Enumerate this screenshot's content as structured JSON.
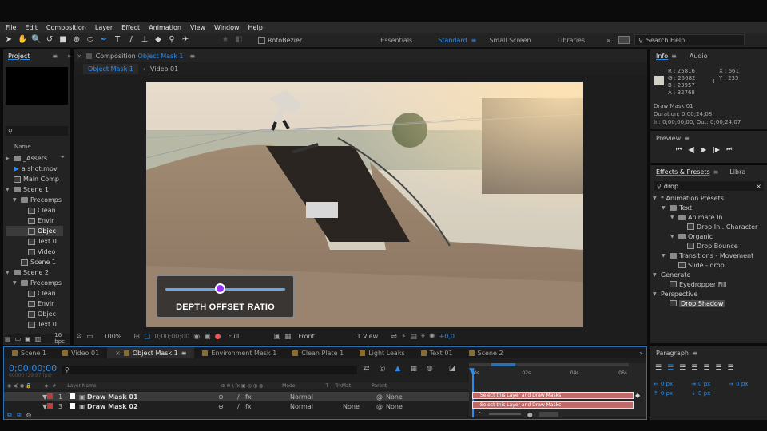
{
  "menu": [
    "File",
    "Edit",
    "Composition",
    "Layer",
    "Effect",
    "Animation",
    "View",
    "Window",
    "Help"
  ],
  "toolbar": {
    "roto_label": "RotoBezier",
    "workspaces": [
      "Essentials",
      "Standard",
      "Small Screen",
      "Libraries"
    ],
    "search_placeholder": "Search Help"
  },
  "project": {
    "tab": "Project",
    "name_header": "Name",
    "items": [
      {
        "label": "_Assets",
        "type": "folder",
        "indent": 0,
        "open": false
      },
      {
        "label": "a shot.mov",
        "type": "footage",
        "indent": 0
      },
      {
        "label": "Main Comp",
        "type": "comp",
        "indent": 0
      },
      {
        "label": "Scene 1",
        "type": "folder",
        "indent": 0,
        "open": true
      },
      {
        "label": "Precomps",
        "type": "folder",
        "indent": 1,
        "open": true
      },
      {
        "label": "Clean",
        "type": "comp",
        "indent": 2
      },
      {
        "label": "Envir",
        "type": "comp",
        "indent": 2
      },
      {
        "label": "Objec",
        "type": "comp",
        "indent": 2,
        "selected": true
      },
      {
        "label": "Text 0",
        "type": "comp",
        "indent": 2
      },
      {
        "label": "Video",
        "type": "comp",
        "indent": 2
      },
      {
        "label": "Scene 1",
        "type": "comp",
        "indent": 1
      },
      {
        "label": "Scene 2",
        "type": "folder",
        "indent": 0,
        "open": true
      },
      {
        "label": "Precomps",
        "type": "folder",
        "indent": 1,
        "open": true
      },
      {
        "label": "Clean",
        "type": "comp",
        "indent": 2
      },
      {
        "label": "Envir",
        "type": "comp",
        "indent": 2
      },
      {
        "label": "Objec",
        "type": "comp",
        "indent": 2
      },
      {
        "label": "Text 0",
        "type": "comp",
        "indent": 2
      }
    ],
    "bpc": "16 bpc"
  },
  "comp": {
    "title": "Composition",
    "title_name": "Object Mask 1",
    "crumbs": [
      "Object Mask 1",
      "Video 01"
    ]
  },
  "overlay": {
    "label": "DEPTH OFFSET RATIO",
    "slider_value": 0.45
  },
  "viewer_bar": {
    "zoom": "100%",
    "timecode": "0;00;00;00",
    "resolution": "Full",
    "view": "Front",
    "views": "1 View",
    "exposure": "+0,0"
  },
  "info": {
    "tabs": [
      "Info",
      "Audio"
    ],
    "r": "R : 25816",
    "g": "G : 25682",
    "b": "B : 23957",
    "a": "A : 32768",
    "x": "X : 661",
    "y": "Y : 235",
    "name": "Draw Mask 01",
    "duration": "Duration: 0;00;24;08",
    "inout": "In: 0;00;00;00, Out: 0;00;24;07",
    "swatch": "#d3d0c7"
  },
  "preview": {
    "tab": "Preview"
  },
  "effects": {
    "tabs": [
      "Effects & Presets",
      "Libra"
    ],
    "search": "drop",
    "items": [
      {
        "label": "* Animation Presets",
        "indent": 0,
        "type": "group"
      },
      {
        "label": "Text",
        "indent": 1,
        "type": "folder"
      },
      {
        "label": "Animate In",
        "indent": 2,
        "type": "folder"
      },
      {
        "label": "Drop In...Character",
        "indent": 3,
        "type": "preset"
      },
      {
        "label": "Organic",
        "indent": 2,
        "type": "folder"
      },
      {
        "label": "Drop Bounce",
        "indent": 3,
        "type": "preset"
      },
      {
        "label": "Transitions - Movement",
        "indent": 1,
        "type": "folder"
      },
      {
        "label": "Slide - drop",
        "indent": 2,
        "type": "preset"
      },
      {
        "label": "Generate",
        "indent": 0,
        "type": "group"
      },
      {
        "label": "Eyedropper Fill",
        "indent": 1,
        "type": "effect"
      },
      {
        "label": "Perspective",
        "indent": 0,
        "type": "group"
      },
      {
        "label": "Drop Shadow",
        "indent": 1,
        "type": "effect",
        "selected": true
      }
    ]
  },
  "paragraph": {
    "tab": "Paragraph",
    "values": [
      "0 px",
      "0 px",
      "0 px",
      "0 px",
      "0 px"
    ]
  },
  "timeline": {
    "tabs": [
      {
        "label": "Scene 1",
        "color": "#8a6d2b"
      },
      {
        "label": "Video 01",
        "color": "#8a6d2b"
      },
      {
        "label": "Object Mask 1",
        "color": "#8a6d2b",
        "active": true
      },
      {
        "label": "Environment Mask 1",
        "color": "#8a6d2b"
      },
      {
        "label": "Clean Plate 1",
        "color": "#8a6d2b"
      },
      {
        "label": "Light Leaks",
        "color": "#8a6d2b"
      },
      {
        "label": "Text 01",
        "color": "#8a6d2b"
      },
      {
        "label": "Scene 2",
        "color": "#8a6d2b"
      }
    ],
    "timecode": "0;00;00;00",
    "fps": "00000 (29.97 fps)",
    "col_layer": "Layer Name",
    "col_mode": "Mode",
    "col_t": "T",
    "col_trkmat": "TrkMat",
    "col_parent": "Parent",
    "ruler": [
      "0s",
      "02s",
      "04s",
      "06s"
    ],
    "layers": [
      {
        "num": "1",
        "name": "Draw Mask 01",
        "mode": "Normal",
        "trkmat": "",
        "parent": "None",
        "track": "Select this Layer and Draw Masks",
        "color": "#c03a3a"
      },
      {
        "num": "3",
        "name": "Draw Mask 02",
        "mode": "Normal",
        "trkmat": "None",
        "parent": "None",
        "track": "Select this Layer and Draw Masks",
        "color": "#c03a3a"
      }
    ]
  }
}
